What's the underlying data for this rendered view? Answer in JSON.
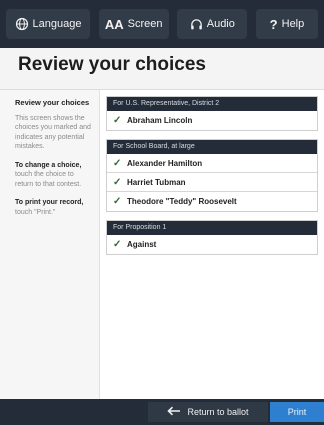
{
  "toolbar": {
    "language_label": "Language",
    "screen_glyph": "AA",
    "screen_label": "Screen",
    "audio_label": "Audio",
    "help_glyph": "?",
    "help_label": "Help",
    "icons": [
      "globe-icon",
      "text-size-icon",
      "headphones-icon",
      "help-icon"
    ]
  },
  "page": {
    "title": "Review your choices"
  },
  "sidebar": {
    "review_heading": "Review your choices",
    "review_body": "This screen shows the choices you marked and indicates any potential mistakes.",
    "change_heading": "To change a choice,",
    "change_body": "touch the choice to return to that contest.",
    "print_heading": "To print your record,",
    "print_body": "touch \"Print.\""
  },
  "contests": [
    {
      "header": "For U.S. Representative, District 2",
      "choices": [
        "Abraham Lincoln"
      ]
    },
    {
      "header": "For School Board, at large",
      "choices": [
        "Alexander Hamilton",
        "Harriet Tubman",
        "Theodore \"Teddy\" Roosevelt"
      ]
    },
    {
      "header": "For Proposition 1",
      "choices": [
        "Against"
      ]
    }
  ],
  "footer": {
    "return_label": "Return to ballot",
    "print_label": "Print"
  },
  "colors": {
    "toolbar_bg": "#232c38",
    "check": "#2f6a3a",
    "print_bg": "#2f7fd0"
  }
}
